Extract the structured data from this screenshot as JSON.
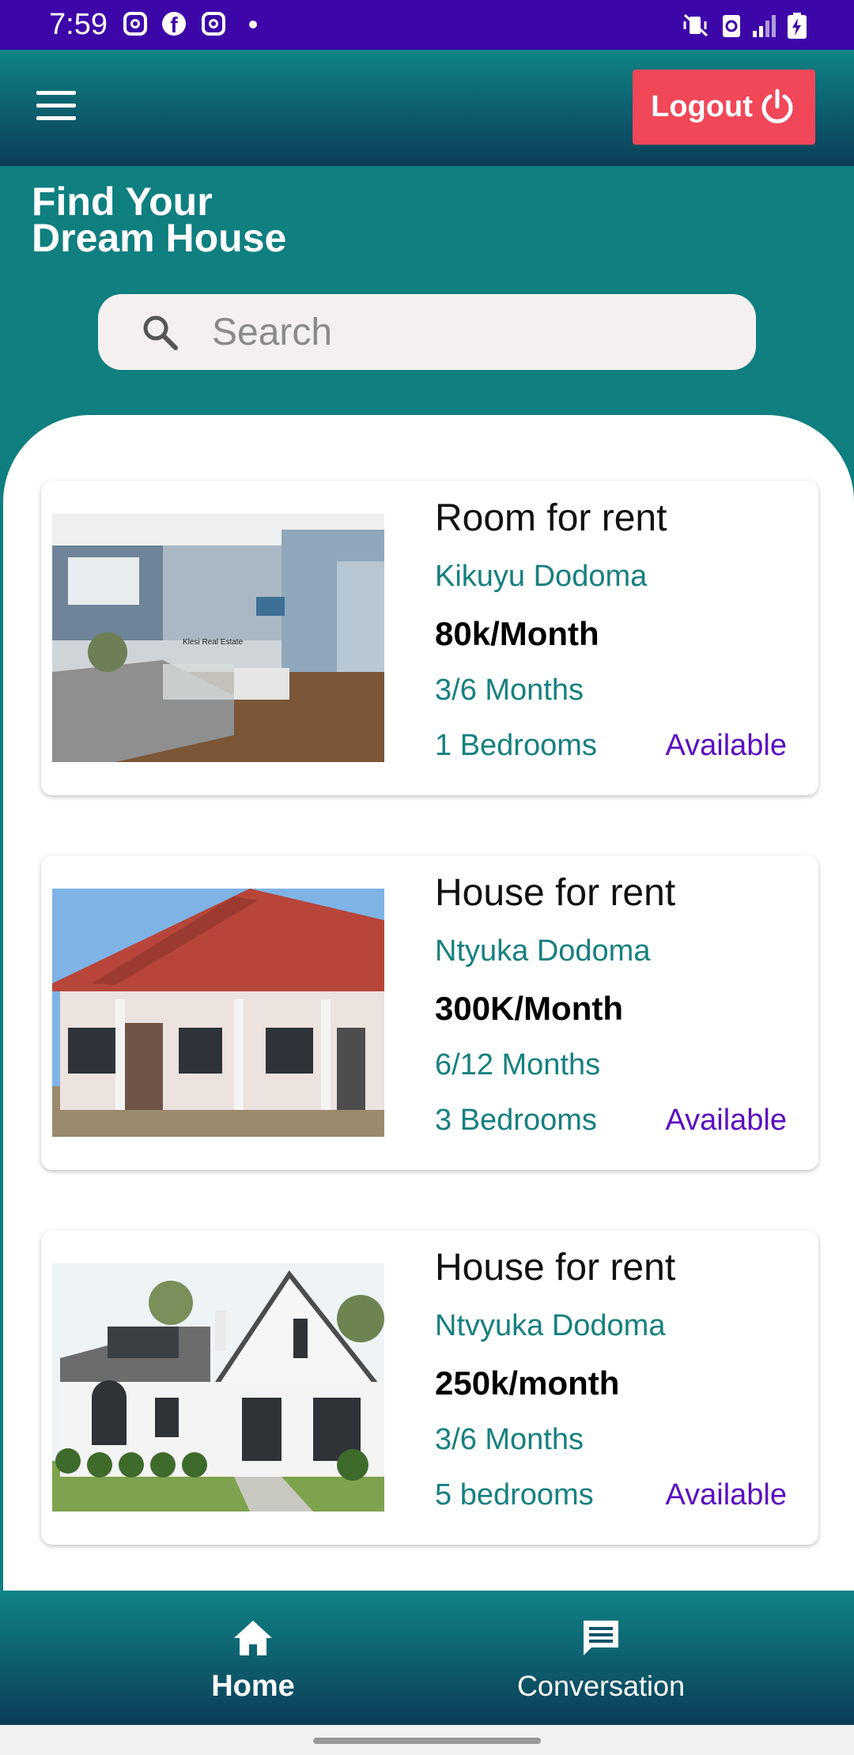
{
  "status_bar": {
    "time": "7:59"
  },
  "app_bar": {
    "logout_label": "Logout"
  },
  "header": {
    "title_line1": "Find Your",
    "title_line2": "Dream House"
  },
  "search": {
    "placeholder": "Search"
  },
  "listings": [
    {
      "title": "Room for rent",
      "location": "Kikuyu Dodoma",
      "price": "80k/Month",
      "duration": "3/6 Months",
      "bedrooms": "1 Bedrooms",
      "status": "Available",
      "image_caption": "Klesi Real Estate"
    },
    {
      "title": "House for rent",
      "location": "Ntyuka Dodoma",
      "price": "300K/Month",
      "duration": "6/12 Months",
      "bedrooms": "3 Bedrooms",
      "status": "Available"
    },
    {
      "title": "House for rent",
      "location": "Ntvyuka Dodoma",
      "price": "250k/month",
      "duration": "3/6 Months",
      "bedrooms": "5 bedrooms",
      "status": "Available"
    }
  ],
  "bottom_nav": {
    "items": [
      {
        "label": "Home",
        "icon": "home-icon"
      },
      {
        "label": "Conversation",
        "icon": "chat-icon"
      }
    ]
  },
  "colors": {
    "status_bar": "#3d06a8",
    "teal": "#0f7f80",
    "logout": "#f04759",
    "accent_text": "#16807f",
    "status_text": "#5a0fc0"
  }
}
